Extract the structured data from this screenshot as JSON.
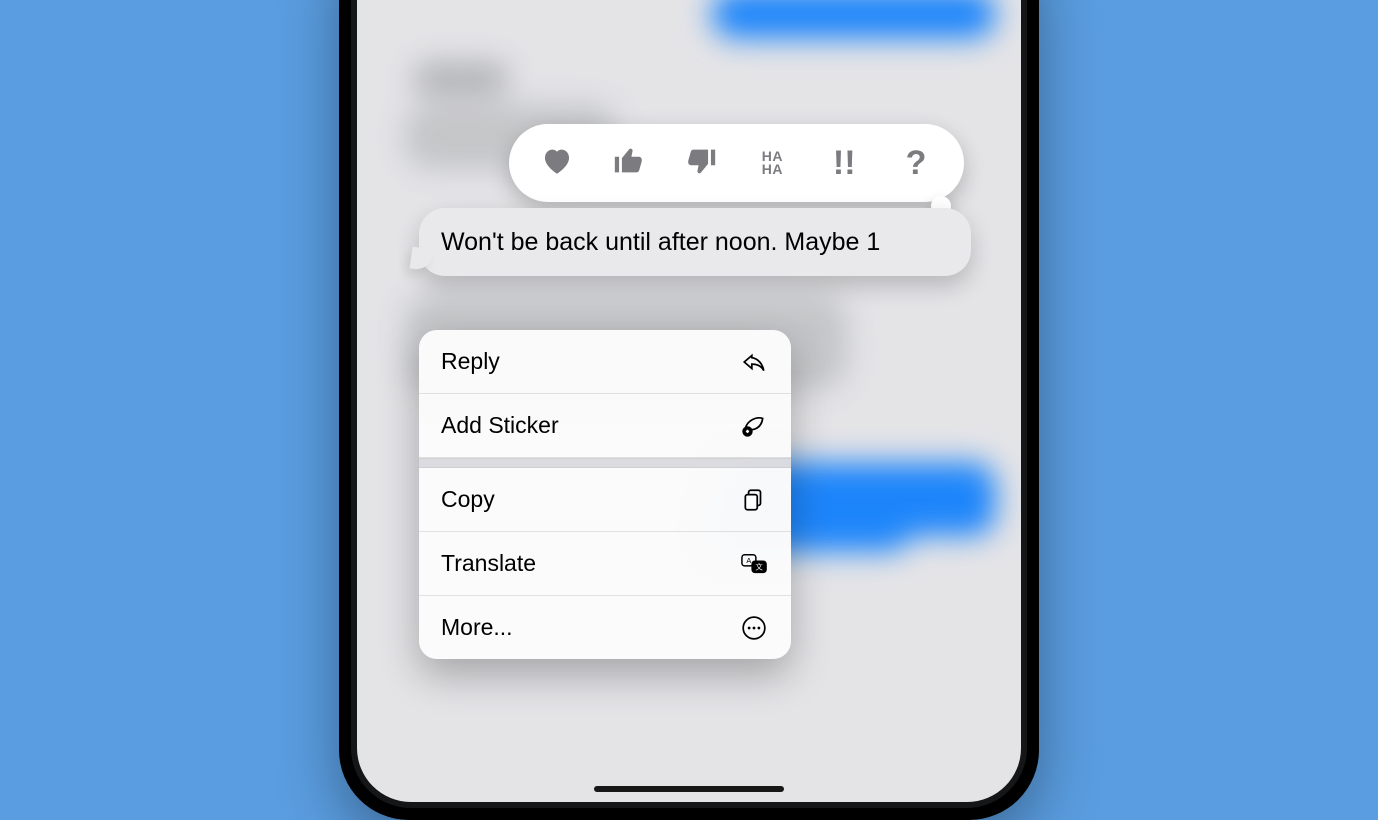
{
  "message": {
    "text": "Won't be back until after noon. Maybe 1"
  },
  "tapback": {
    "reactions": [
      {
        "name": "heart",
        "glyph": "heart"
      },
      {
        "name": "thumbs-up",
        "glyph": "thumbs-up"
      },
      {
        "name": "thumbs-down",
        "glyph": "thumbs-down"
      },
      {
        "name": "haha",
        "glyph": "HA HA"
      },
      {
        "name": "exclaim",
        "glyph": "!!"
      },
      {
        "name": "question",
        "glyph": "?"
      }
    ]
  },
  "menu": {
    "items": [
      {
        "label": "Reply",
        "icon": "reply"
      },
      {
        "label": "Add Sticker",
        "icon": "sticker"
      },
      {
        "label": "Copy",
        "icon": "copy"
      },
      {
        "label": "Translate",
        "icon": "translate"
      },
      {
        "label": "More...",
        "icon": "ellipsis"
      }
    ]
  }
}
